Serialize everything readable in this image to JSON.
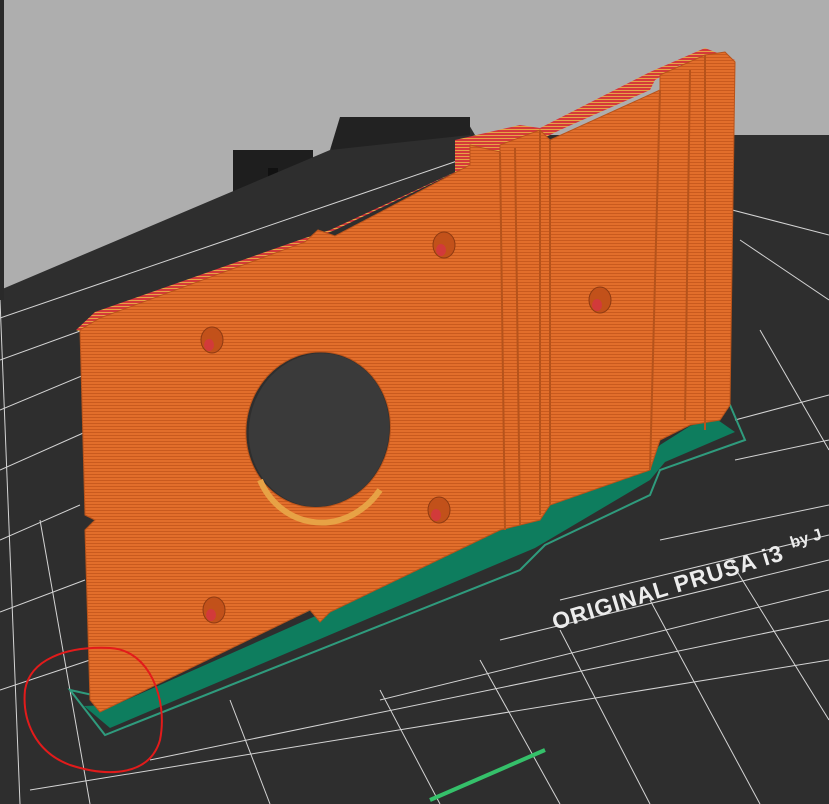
{
  "viewer": {
    "bed_logo": "ORIGINAL PRUSA i3 ",
    "bed_logo_sub": "by J"
  },
  "colors": {
    "background": "#aeaeae",
    "bed": "#2f2f2f",
    "grid": "#e6e6e6",
    "perimeter": "#e06d2a",
    "infill_top": "#cf3a3a",
    "brim": "#0e7d5e",
    "skirt": "#2f9b7d",
    "annotation": "#e21b1b"
  },
  "legend": {
    "perimeter": "external-perimeter",
    "brim": "brim",
    "skirt": "skirt"
  }
}
